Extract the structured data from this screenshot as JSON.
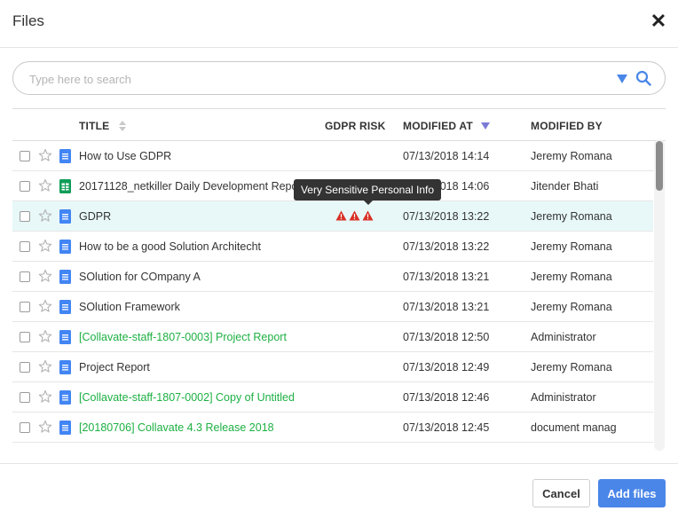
{
  "dialog": {
    "title": "Files",
    "close_icon": "close-icon"
  },
  "search": {
    "placeholder": "Type here to search",
    "value": "",
    "dropdown_icon": "triangle-down-icon",
    "search_icon": "search-icon"
  },
  "table": {
    "columns": {
      "title": "TITLE",
      "risk": "GDPR RISK",
      "modified_at": "MODIFIED AT",
      "modified_by": "MODIFIED BY"
    },
    "sort": {
      "column": "modified_at",
      "direction": "desc"
    },
    "rows": [
      {
        "name": "How to Use GDPR",
        "type": "doc",
        "risk": 0,
        "date": "07/13/2018 14:14",
        "user": "Jeremy Romana",
        "green": false
      },
      {
        "name": "20171128_netkiller Daily Development Repo...",
        "type": "sheet",
        "risk": 0,
        "date": "07/13/2018 14:06",
        "user": "Jitender Bhati",
        "green": false
      },
      {
        "name": "GDPR",
        "type": "doc",
        "risk": 3,
        "date": "07/13/2018 13:22",
        "user": "Jeremy Romana",
        "green": false
      },
      {
        "name": "How to be a good Solution Architecht",
        "type": "doc",
        "risk": 0,
        "date": "07/13/2018 13:22",
        "user": "Jeremy Romana",
        "green": false
      },
      {
        "name": "SOlution for COmpany A",
        "type": "doc",
        "risk": 0,
        "date": "07/13/2018 13:21",
        "user": "Jeremy Romana",
        "green": false
      },
      {
        "name": "SOlution Framework",
        "type": "doc",
        "risk": 0,
        "date": "07/13/2018 13:21",
        "user": "Jeremy Romana",
        "green": false
      },
      {
        "name": "[Collavate-staff-1807-0003] Project Report",
        "type": "doc",
        "risk": 0,
        "date": "07/13/2018 12:50",
        "user": "Administrator",
        "green": true
      },
      {
        "name": "Project Report",
        "type": "doc",
        "risk": 0,
        "date": "07/13/2018 12:49",
        "user": "Jeremy Romana",
        "green": false
      },
      {
        "name": "[Collavate-staff-1807-0002] Copy of Untitled",
        "type": "doc",
        "risk": 0,
        "date": "07/13/2018 12:46",
        "user": "Administrator",
        "green": true
      },
      {
        "name": "[20180706] Collavate 4.3 Release 2018",
        "type": "doc",
        "risk": 0,
        "date": "07/13/2018 12:45",
        "user": "document manag",
        "green": true
      }
    ]
  },
  "tooltip": {
    "text": "Very Sensitive Personal Info"
  },
  "footer": {
    "cancel_label": "Cancel",
    "add_label": "Add files"
  },
  "colors": {
    "accent": "#4a86e8",
    "green_title": "#1db043",
    "risk_red": "#d93025",
    "selected_row": "#e8f8f8",
    "doc_icon": "#4285f4",
    "sheet_icon": "#0f9d58"
  }
}
